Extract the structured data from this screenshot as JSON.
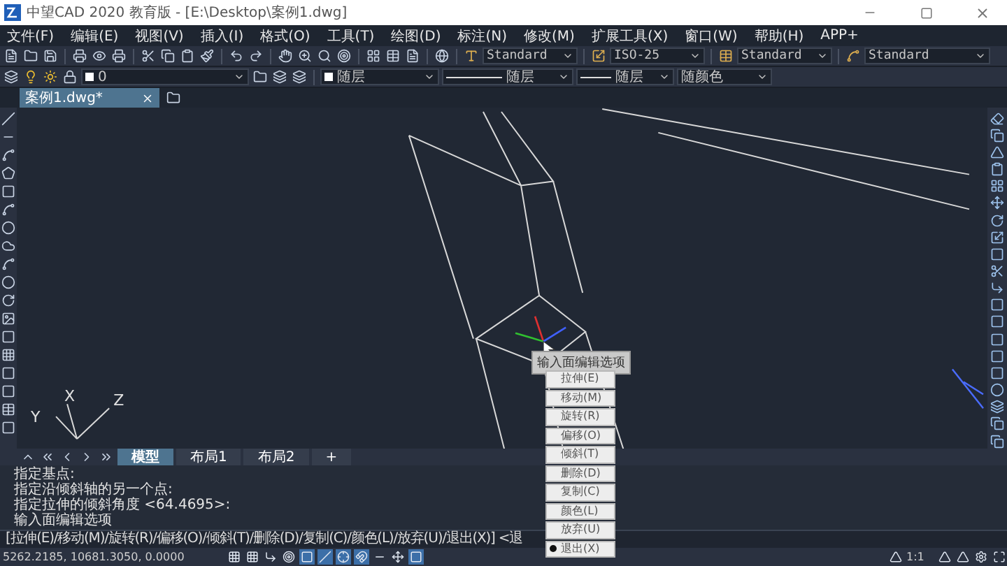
{
  "window": {
    "title": "中望CAD 2020 教育版 - [E:\\Desktop\\案例1.dwg]"
  },
  "menu_bar": [
    "文件(F)",
    "编辑(E)",
    "视图(V)",
    "插入(I)",
    "格式(O)",
    "工具(T)",
    "绘图(D)",
    "标注(N)",
    "修改(M)",
    "扩展工具(X)",
    "窗口(W)",
    "帮助(H)",
    "APP+"
  ],
  "style_toolbar": [
    {
      "value": "Standard"
    },
    {
      "value": "ISO-25"
    },
    {
      "value": "Standard"
    },
    {
      "value": "Standard"
    }
  ],
  "property_toolbar": {
    "layer": "0",
    "dropdowns": [
      "随层",
      "随层",
      "随层",
      "随颜色"
    ]
  },
  "document_tabs": [
    {
      "label": "案例1.dwg*",
      "selected": true
    }
  ],
  "canvas": {
    "axis_labels": [
      "X",
      "Y",
      "Z"
    ]
  },
  "tooltip": "输入面编辑选项",
  "context_menu": [
    {
      "label": "拉伸(E)",
      "selected": false
    },
    {
      "label": "移动(M)",
      "selected": false
    },
    {
      "label": "旋转(R)",
      "selected": false
    },
    {
      "label": "偏移(O)",
      "selected": false
    },
    {
      "label": "倾斜(T)",
      "selected": false
    },
    {
      "label": "删除(D)",
      "selected": false
    },
    {
      "label": "复制(C)",
      "selected": false
    },
    {
      "label": "颜色(L)",
      "selected": false
    },
    {
      "label": "放弃(U)",
      "selected": false
    },
    {
      "label": "退出(X)",
      "selected": true
    }
  ],
  "layout_tabs": [
    {
      "label": "模型",
      "selected": true
    },
    {
      "label": "布局1",
      "selected": false
    },
    {
      "label": "布局2",
      "selected": false
    },
    {
      "label": "+",
      "selected": false
    }
  ],
  "command_history": [
    "指定基点:",
    "指定沿倾斜轴的另一个点:",
    "指定拉伸的倾斜角度 <64.4695>:",
    "输入面编辑选项"
  ],
  "command_prompt": "[拉伸(E)/移动(M)/旋转(R)/偏移(O)/倾斜(T)/删除(D)/复制(C)/颜色(L)/放弃(U)/退出(X)] <退",
  "status_bar": {
    "coordinates": "5262.2185, 10681.3050, 0.0000",
    "scale": "1:1"
  }
}
